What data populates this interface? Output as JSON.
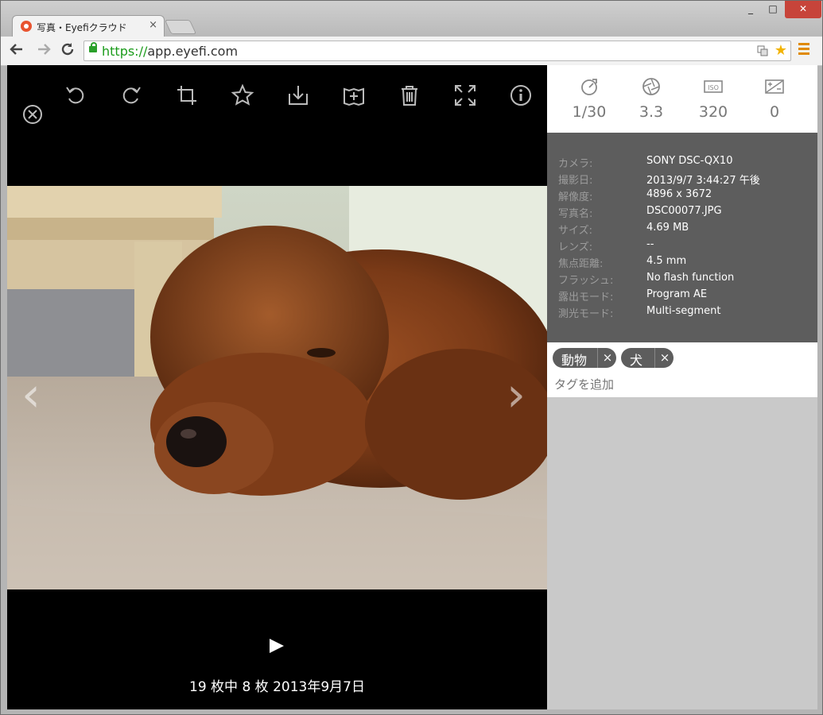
{
  "browser": {
    "tab_title": "写真・Eyefiクラウド",
    "tab_close": "×",
    "url_scheme": "https://",
    "url_rest": "app.eyefi.com",
    "window_min": "_",
    "window_max": "□",
    "window_close": "✕"
  },
  "viewer": {
    "tools": [
      "rotate-left-icon",
      "rotate-right-icon",
      "crop-icon",
      "star-icon",
      "download-icon",
      "add-to-album-icon",
      "trash-icon",
      "fullscreen-icon",
      "info-icon"
    ],
    "close_icon": "close-circle-icon",
    "prev_arrow": "‹",
    "next_arrow": "›",
    "counter": "19 枚中 8 枚  2013年9月7日"
  },
  "exposure": {
    "shutter": "1/30",
    "aperture": "3.3",
    "iso": "320",
    "ev": "0",
    "iso_icon_label": "ISO"
  },
  "metadata": [
    {
      "key": "カメラ:",
      "value": "SONY DSC-QX10"
    },
    {
      "key": "撮影日:",
      "value": "2013/9/7 3:44:27 午後"
    },
    {
      "key": "解像度:",
      "value": "4896 x 3672"
    },
    {
      "key": "写真名:",
      "value": "DSC00077.JPG"
    },
    {
      "key": "サイズ:",
      "value": "4.69 MB"
    },
    {
      "key": "レンズ:",
      "value": "--"
    },
    {
      "key": "焦点距離:",
      "value": "4.5 mm"
    },
    {
      "key": "フラッシュ:",
      "value": "No flash function"
    },
    {
      "key": "露出モード:",
      "value": "Program AE"
    },
    {
      "key": "測光モード:",
      "value": "Multi-segment"
    }
  ],
  "tags": {
    "items": [
      {
        "label": "動物",
        "remove": "×"
      },
      {
        "label": "犬",
        "remove": "×"
      }
    ],
    "placeholder": "タグを追加"
  },
  "colors": {
    "accent_close": "#c7443a",
    "meta_bg": "#5d5d5d",
    "viewer_bg": "#000000"
  }
}
